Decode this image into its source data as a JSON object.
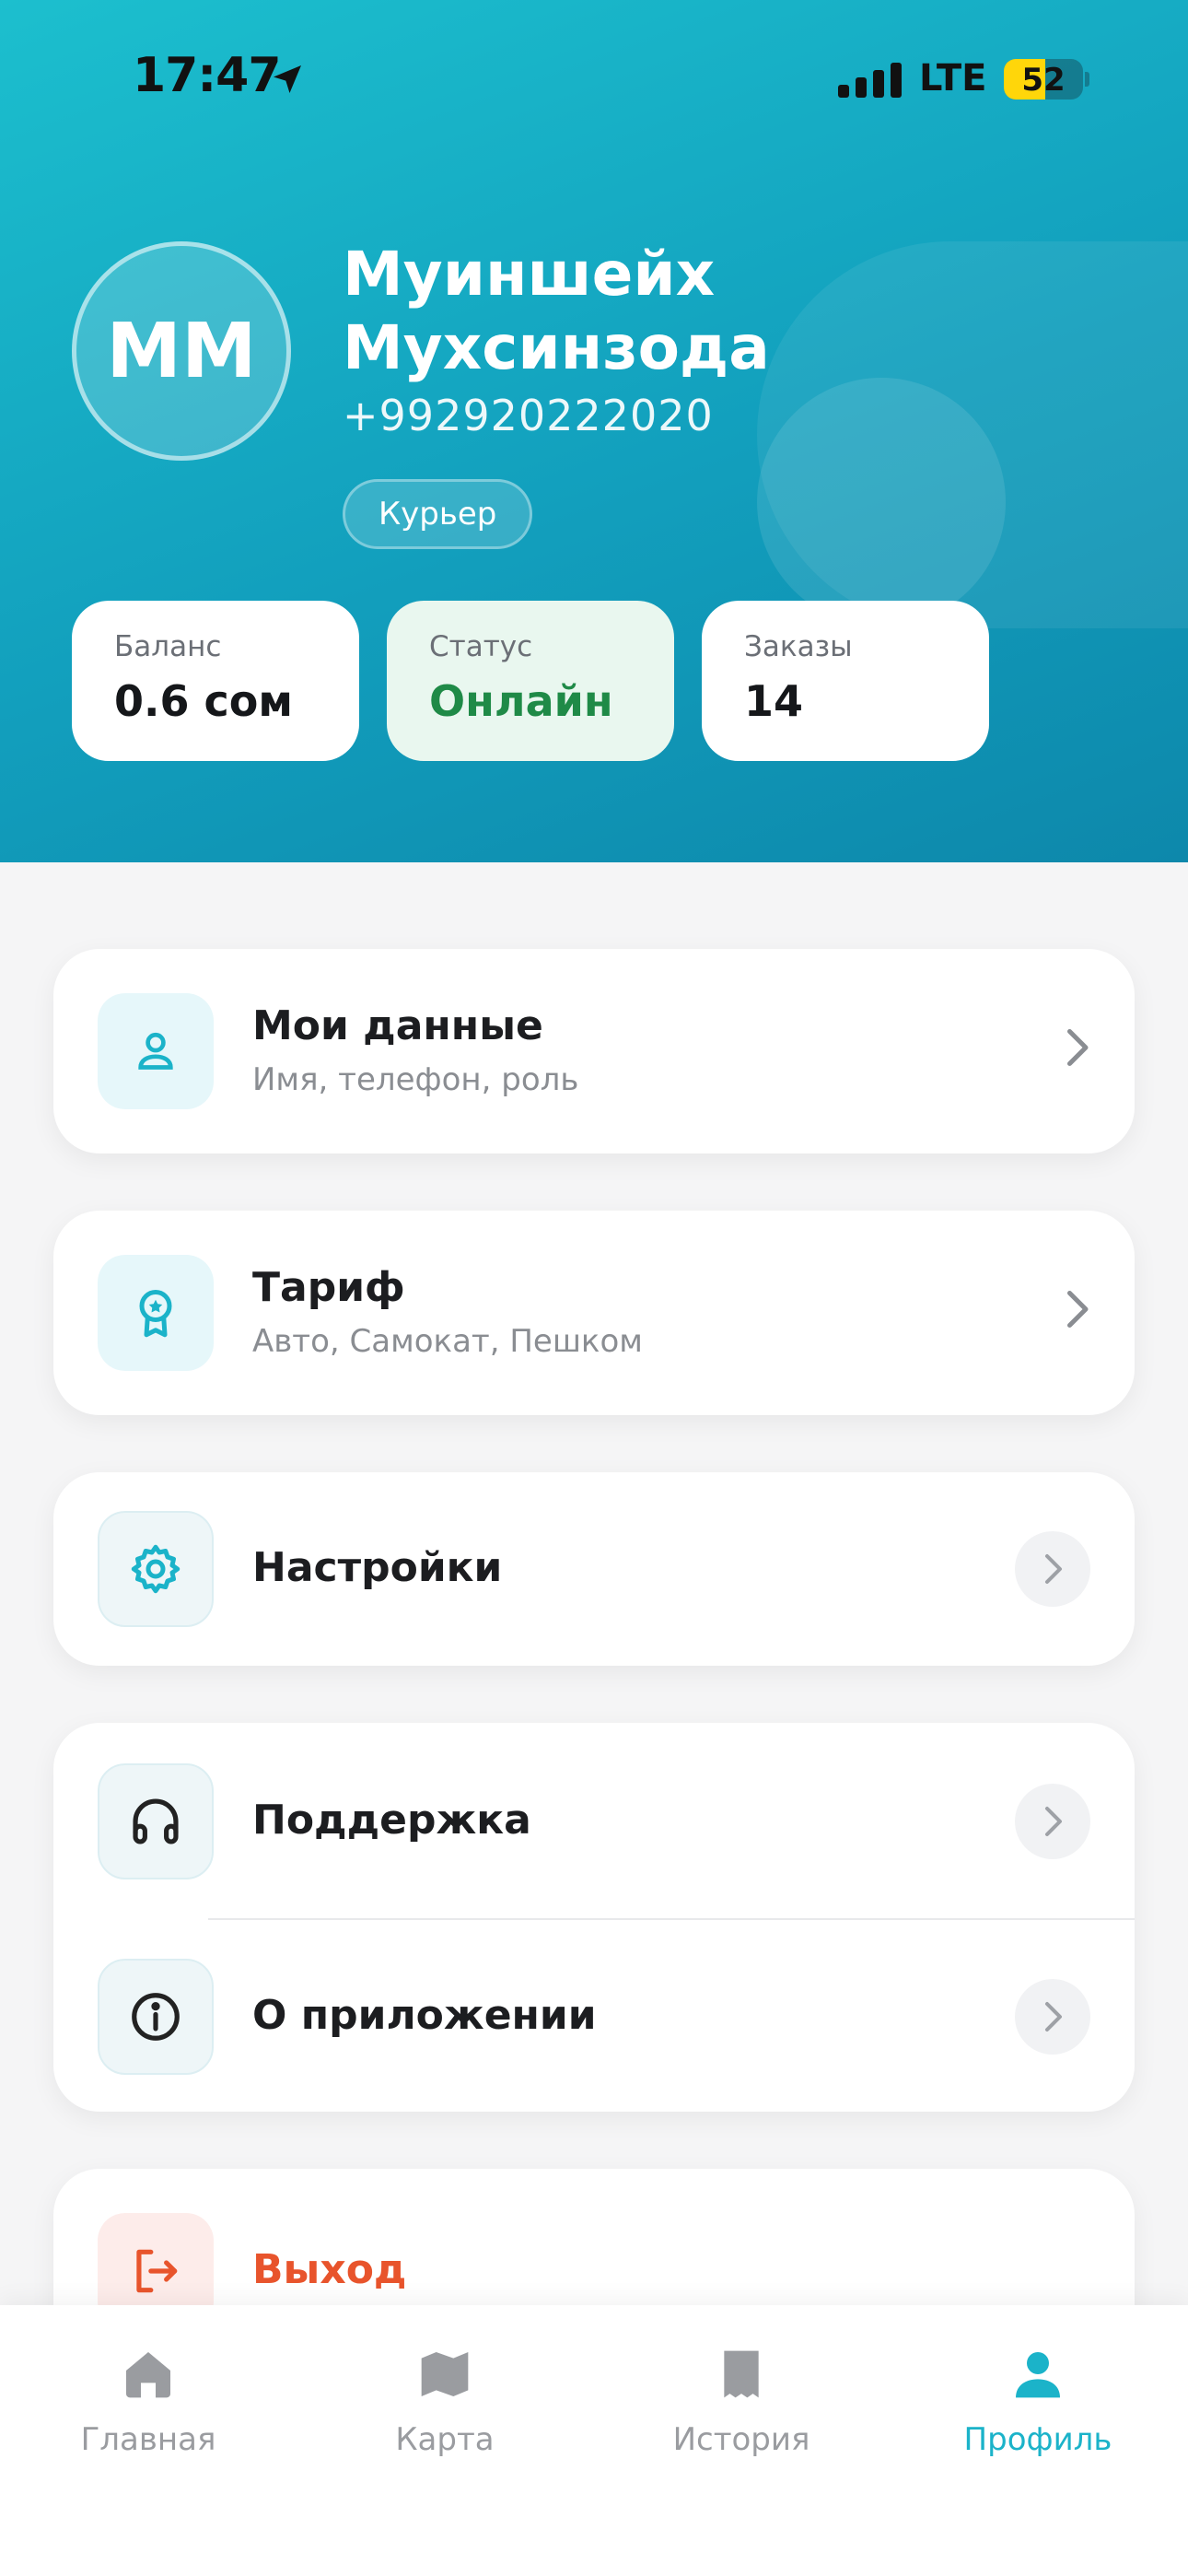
{
  "status_bar": {
    "time": "17:47",
    "network": "LTE",
    "battery": "52"
  },
  "profile": {
    "initials": "ММ",
    "name_line1": "Муиншейх",
    "name_line2": "Мухсинзода",
    "phone": "+992920222020",
    "role": "Курьер"
  },
  "stats": [
    {
      "label": "Баланс",
      "value": "0.6 сом"
    },
    {
      "label": "Статус",
      "value": "Онлайн"
    },
    {
      "label": "Заказы",
      "value": "14"
    }
  ],
  "menu": {
    "my_data": {
      "title": "Мои данные",
      "subtitle": "Имя, телефон, роль"
    },
    "tariff": {
      "title": "Тариф",
      "subtitle": "Авто, Самокат, Пешком"
    },
    "settings": {
      "title": "Настройки"
    },
    "support": {
      "title": "Поддержка"
    },
    "about": {
      "title": "О приложении"
    },
    "logout": {
      "title": "Выход"
    }
  },
  "tabs": [
    {
      "label": "Главная",
      "icon": "home-icon"
    },
    {
      "label": "Карта",
      "icon": "map-icon"
    },
    {
      "label": "История",
      "icon": "history-icon"
    },
    {
      "label": "Профиль",
      "icon": "profile-icon",
      "active": true
    }
  ],
  "colors": {
    "accent": "#1bb3c9",
    "online": "#1f8a47",
    "logout": "#e8542c",
    "header_start": "#1cbfce",
    "header_end": "#0d88ab"
  }
}
